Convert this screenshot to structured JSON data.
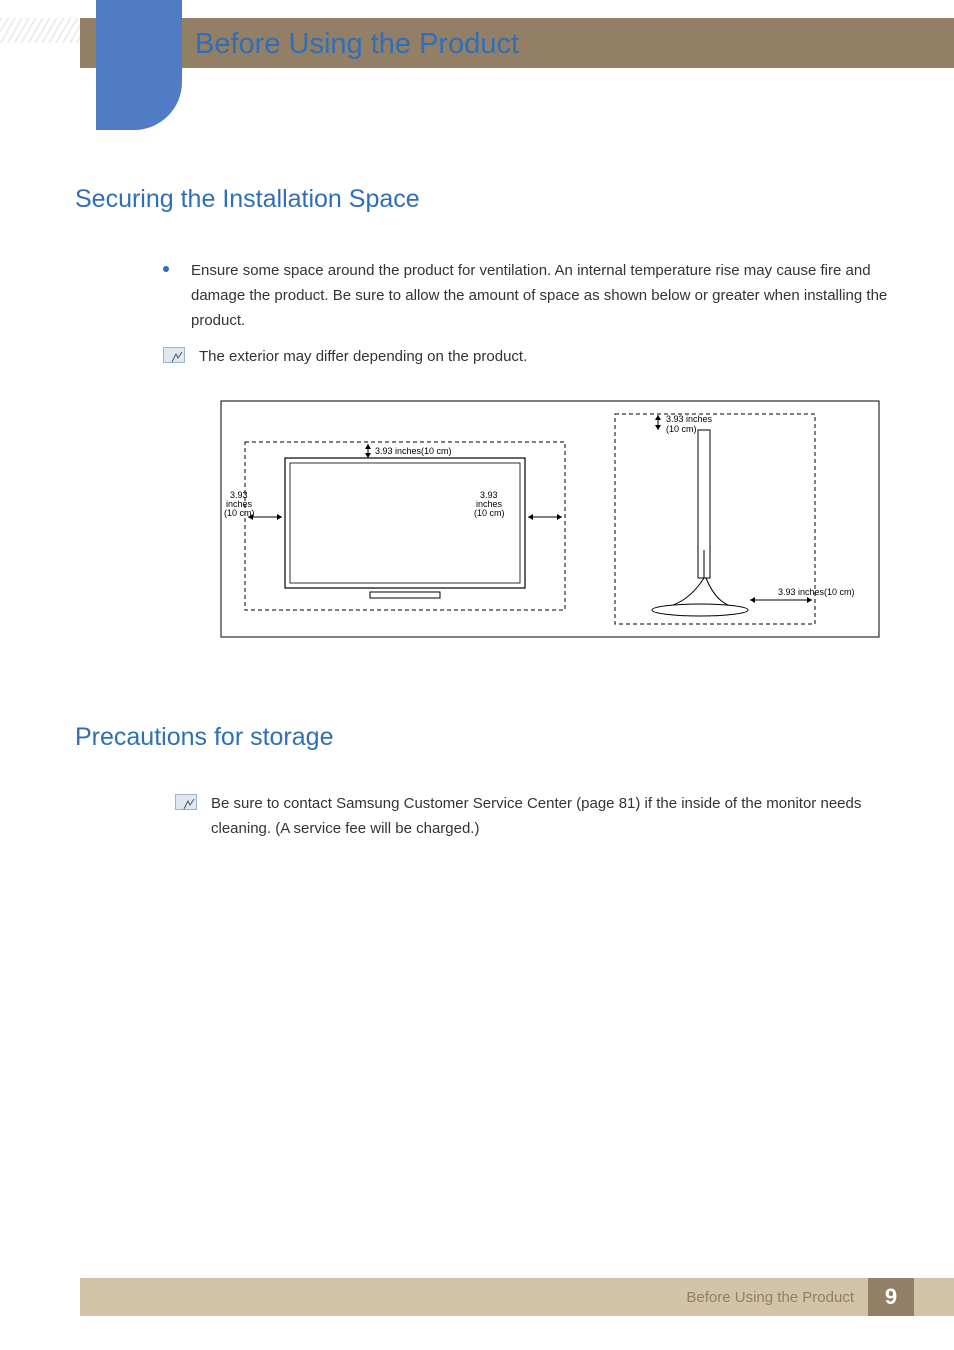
{
  "header": {
    "title": "Before Using the Product"
  },
  "section1": {
    "heading": "Securing the Installation Space",
    "bullet": "Ensure some space around the product for ventilation. An internal temperature rise may cause fire and damage the product. Be sure to allow the amount of space as shown below or greater when installing the product.",
    "note": "The exterior may differ depending on the product."
  },
  "diagram": {
    "label_top_left": "3.93 inches(10 cm)",
    "label_left_side": "3.93 inches (10 cm)",
    "label_right_side": "3.93 inches (10 cm)",
    "label_top_right": "3.93 inches (10 cm)",
    "label_bottom_right": "3.93 inches(10 cm)"
  },
  "section2": {
    "heading": "Precautions for storage",
    "note": "Be sure to contact Samsung Customer Service Center (page 81) if the inside of the monitor needs cleaning. (A service fee will be charged.)"
  },
  "footer": {
    "text": "Before Using the Product",
    "page": "9"
  }
}
